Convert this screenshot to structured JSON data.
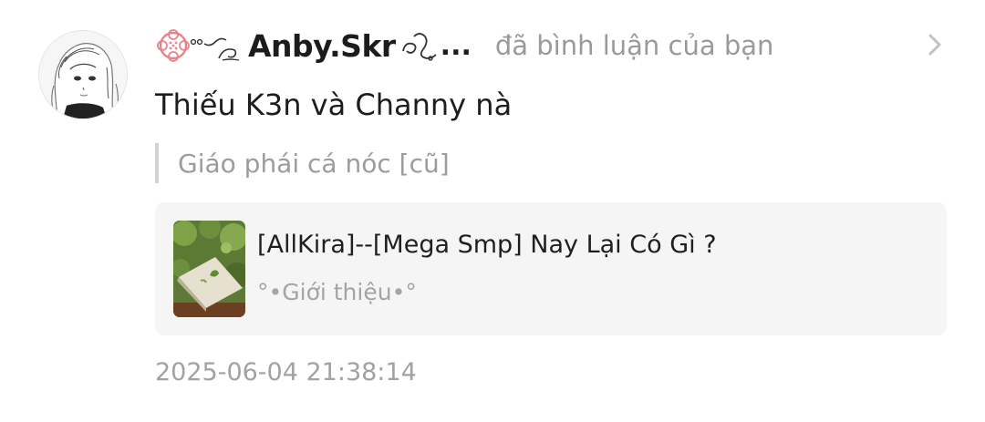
{
  "user": {
    "name": "Anby.Skr",
    "avatar_icon": "anime-girl-sketch-avatar",
    "decoration_left": "flower-ribbon-decoration",
    "decoration_right": "swirl-decoration",
    "truncation": "..."
  },
  "notification": {
    "action": "đã bình luận của bạn",
    "chevron_icon": "chevron-right-icon",
    "comment": "Thiếu K3n và Channy nà",
    "quoted": "Giáo phái cá nóc [cũ]",
    "timestamp": "2025-06-04 21:38:14"
  },
  "story": {
    "title": "[AllKira]--[Mega Smp] Nay Lại Có Gì ?",
    "subtitle": "°•Giới thiệu•°",
    "cover_icon": "book-cover-thumbnail"
  },
  "colors": {
    "text_primary": "#1d1d1d",
    "text_secondary": "#9a9a9a",
    "card_background": "#f5f5f5",
    "flower_pink": "#e7838b"
  }
}
